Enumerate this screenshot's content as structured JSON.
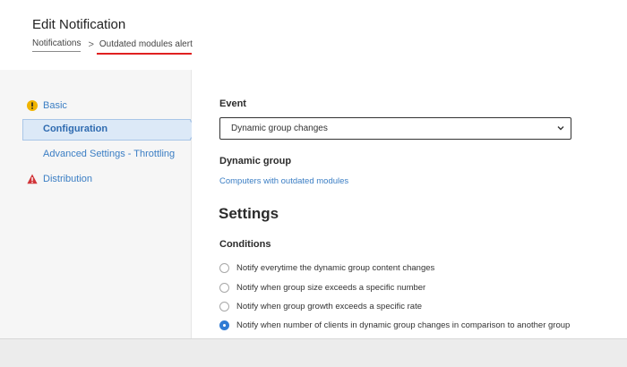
{
  "header": {
    "title": "Edit Notification",
    "breadcrumb": {
      "parent": "Notifications",
      "separator": ">",
      "current": "Outdated modules alert"
    }
  },
  "sidebar": {
    "items": [
      {
        "label": "Basic",
        "icon": "warning-circle-icon",
        "icon_color": "#f0b400"
      },
      {
        "label": "Configuration",
        "active": true
      },
      {
        "label": "Advanced Settings - Throttling"
      },
      {
        "label": "Distribution",
        "icon": "error-triangle-icon",
        "icon_color": "#d13438"
      }
    ]
  },
  "main": {
    "event": {
      "label": "Event",
      "selected": "Dynamic group changes"
    },
    "dynamic_group": {
      "label": "Dynamic group",
      "link": "Computers with outdated modules"
    },
    "settings_heading": "Settings",
    "conditions": {
      "label": "Conditions",
      "options": [
        "Notify everytime the dynamic group content changes",
        "Notify when group size exceeds a specific number",
        "Notify when group growth exceeds a specific rate",
        "Notify when number of clients in dynamic group changes in comparison to another group"
      ],
      "selected_index": 3
    }
  },
  "colors": {
    "link": "#3b7ec4",
    "accent_radio": "#2f7bd4",
    "annotation_underline": "#e02020",
    "active_item_bg": "#dce9f7"
  }
}
